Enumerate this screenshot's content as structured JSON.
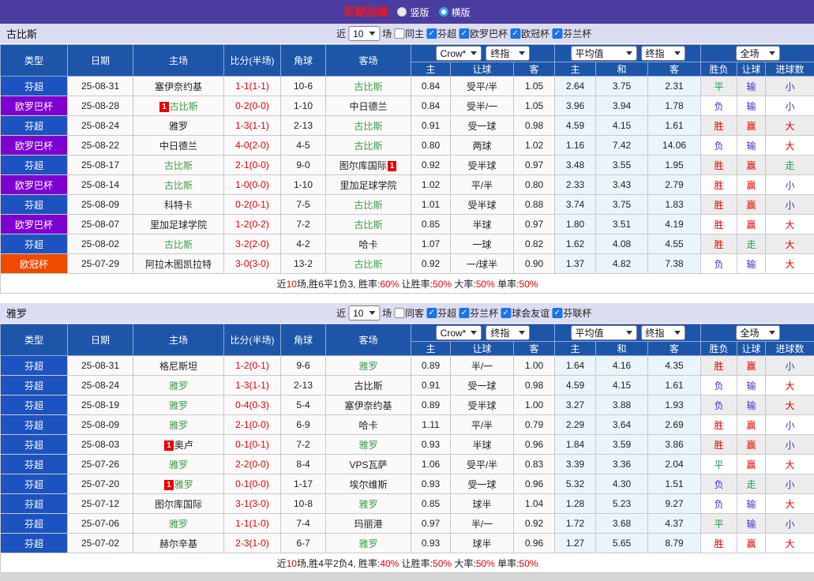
{
  "header": {
    "title": "近期战绩",
    "radios": [
      {
        "label": "竖版",
        "checked": false
      },
      {
        "label": "横版",
        "checked": true
      }
    ]
  },
  "controls": {
    "bookmaker": "Crow*",
    "stage": "终指",
    "average": "平均值",
    "stage2": "终指",
    "scope": "全场"
  },
  "thead": {
    "type": "类型",
    "date": "日期",
    "home": "主场",
    "score": "比分(半场)",
    "corner": "角球",
    "away": "客场",
    "sub": [
      "主",
      "让球",
      "客",
      "主",
      "和",
      "客",
      "胜负",
      "让球",
      "进球数"
    ]
  },
  "colors": {
    "topbar_purple": "#4b3c9f",
    "header_blue": "#1d55a9",
    "league": {
      "芬超": "#1c53c0",
      "欧罗巴杯": "#7e00d0",
      "欧冠杯": "#f04a00"
    },
    "result": {
      "胜": "#e60000",
      "赢": "#e60000",
      "大": "#e60000",
      "负": "#3535d6",
      "输": "#3535d6",
      "小": "#3535d6",
      "平": "#1e9e46",
      "走": "#1e9e46"
    },
    "team_green": "#3c9e4a",
    "score_red": "#e60000",
    "check_blue": "#1b74e8"
  },
  "sections": [
    {
      "team": "古比斯",
      "filter": {
        "near": "近",
        "count": "10",
        "games": "场",
        "same": {
          "label": "同主",
          "checked": false
        },
        "leagues": [
          {
            "label": "芬超",
            "checked": true
          },
          {
            "label": "欧罗巴杯",
            "checked": true
          },
          {
            "label": "欧冠杯",
            "checked": true
          },
          {
            "label": "芬兰杯",
            "checked": true
          }
        ]
      },
      "rows": [
        {
          "lg": "芬超",
          "date": "25-08-31",
          "home": {
            "n": "塞伊奈约基"
          },
          "score": "1-1(1-1)",
          "corner": "10-6",
          "away": {
            "n": "古比斯",
            "g": 1
          },
          "o": [
            "0.84",
            "受平/半",
            "1.05"
          ],
          "avg": [
            "2.64",
            "3.75",
            "2.31"
          ],
          "res": [
            "平",
            "输",
            "小"
          ]
        },
        {
          "lg": "欧罗巴杯",
          "date": "25-08-28",
          "home": {
            "n": "古比斯",
            "g": 1,
            "cb": 1
          },
          "score": "0-2(0-0)",
          "corner": "1-10",
          "away": {
            "n": "中日德兰"
          },
          "o": [
            "0.84",
            "受半/一",
            "1.05"
          ],
          "avg": [
            "3.96",
            "3.94",
            "1.78"
          ],
          "res": [
            "负",
            "输",
            "小"
          ]
        },
        {
          "lg": "芬超",
          "date": "25-08-24",
          "home": {
            "n": "雅罗"
          },
          "score": "1-3(1-1)",
          "corner": "2-13",
          "away": {
            "n": "古比斯",
            "g": 1
          },
          "o": [
            "0.91",
            "受一球",
            "0.98"
          ],
          "avg": [
            "4.59",
            "4.15",
            "1.61"
          ],
          "res": [
            "胜",
            "赢",
            "大"
          ]
        },
        {
          "lg": "欧罗巴杯",
          "date": "25-08-22",
          "home": {
            "n": "中日德兰"
          },
          "score": "4-0(2-0)",
          "corner": "4-5",
          "away": {
            "n": "古比斯",
            "g": 1
          },
          "o": [
            "0.80",
            "两球",
            "1.02"
          ],
          "avg": [
            "1.16",
            "7.42",
            "14.06"
          ],
          "res": [
            "负",
            "输",
            "大"
          ]
        },
        {
          "lg": "芬超",
          "date": "25-08-17",
          "home": {
            "n": "古比斯",
            "g": 1
          },
          "score": "2-1(0-0)",
          "corner": "9-0",
          "away": {
            "n": "图尔库国际",
            "ca": 1
          },
          "o": [
            "0.92",
            "受半球",
            "0.97"
          ],
          "avg": [
            "3.48",
            "3.55",
            "1.95"
          ],
          "res": [
            "胜",
            "赢",
            "走"
          ]
        },
        {
          "lg": "欧罗巴杯",
          "date": "25-08-14",
          "home": {
            "n": "古比斯",
            "g": 1
          },
          "score": "1-0(0-0)",
          "corner": "1-10",
          "away": {
            "n": "里加足球学院"
          },
          "o": [
            "1.02",
            "平/半",
            "0.80"
          ],
          "avg": [
            "2.33",
            "3.43",
            "2.79"
          ],
          "res": [
            "胜",
            "赢",
            "小"
          ]
        },
        {
          "lg": "芬超",
          "date": "25-08-09",
          "home": {
            "n": "科特卡"
          },
          "score": "0-2(0-1)",
          "corner": "7-5",
          "away": {
            "n": "古比斯",
            "g": 1
          },
          "o": [
            "1.01",
            "受半球",
            "0.88"
          ],
          "avg": [
            "3.74",
            "3.75",
            "1.83"
          ],
          "res": [
            "胜",
            "赢",
            "小"
          ]
        },
        {
          "lg": "欧罗巴杯",
          "date": "25-08-07",
          "home": {
            "n": "里加足球学院"
          },
          "score": "1-2(0-2)",
          "corner": "7-2",
          "away": {
            "n": "古比斯",
            "g": 1
          },
          "o": [
            "0.85",
            "半球",
            "0.97"
          ],
          "avg": [
            "1.80",
            "3.51",
            "4.19"
          ],
          "res": [
            "胜",
            "赢",
            "大"
          ]
        },
        {
          "lg": "芬超",
          "date": "25-08-02",
          "home": {
            "n": "古比斯",
            "g": 1
          },
          "score": "3-2(2-0)",
          "corner": "4-2",
          "away": {
            "n": "哈卡"
          },
          "o": [
            "1.07",
            "一球",
            "0.82"
          ],
          "avg": [
            "1.62",
            "4.08",
            "4.55"
          ],
          "res": [
            "胜",
            "走",
            "大"
          ]
        },
        {
          "lg": "欧冠杯",
          "date": "25-07-29",
          "home": {
            "n": "阿拉木图凯拉特"
          },
          "score": "3-0(3-0)",
          "corner": "13-2",
          "away": {
            "n": "古比斯",
            "g": 1
          },
          "o": [
            "0.92",
            "一/球半",
            "0.90"
          ],
          "avg": [
            "1.37",
            "4.82",
            "7.38"
          ],
          "res": [
            "负",
            "输",
            "大"
          ]
        }
      ],
      "summary": [
        {
          "t": "近"
        },
        {
          "t": "10",
          "r": 1
        },
        {
          "t": "场,胜6平1负3, 胜率:"
        },
        {
          "t": "60%",
          "r": 1
        },
        {
          "t": " 让胜率:"
        },
        {
          "t": "50%",
          "r": 1
        },
        {
          "t": " 大率:"
        },
        {
          "t": "50%",
          "r": 1
        },
        {
          "t": " 单率:"
        },
        {
          "t": "50%",
          "r": 1
        }
      ]
    },
    {
      "team": "雅罗",
      "filter": {
        "near": "近",
        "count": "10",
        "games": "场",
        "same": {
          "label": "同客",
          "checked": false
        },
        "leagues": [
          {
            "label": "芬超",
            "checked": true
          },
          {
            "label": "芬兰杯",
            "checked": true
          },
          {
            "label": "球会友谊",
            "checked": true
          },
          {
            "label": "芬联杯",
            "checked": true
          }
        ]
      },
      "rows": [
        {
          "lg": "芬超",
          "date": "25-08-31",
          "home": {
            "n": "格尼斯坦"
          },
          "score": "1-2(0-1)",
          "corner": "9-6",
          "away": {
            "n": "雅罗",
            "g": 1
          },
          "o": [
            "0.89",
            "半/一",
            "1.00"
          ],
          "avg": [
            "1.64",
            "4.16",
            "4.35"
          ],
          "res": [
            "胜",
            "赢",
            "小"
          ]
        },
        {
          "lg": "芬超",
          "date": "25-08-24",
          "home": {
            "n": "雅罗",
            "g": 1
          },
          "score": "1-3(1-1)",
          "corner": "2-13",
          "away": {
            "n": "古比斯"
          },
          "o": [
            "0.91",
            "受一球",
            "0.98"
          ],
          "avg": [
            "4.59",
            "4.15",
            "1.61"
          ],
          "res": [
            "负",
            "输",
            "大"
          ]
        },
        {
          "lg": "芬超",
          "date": "25-08-19",
          "home": {
            "n": "雅罗",
            "g": 1
          },
          "score": "0-4(0-3)",
          "corner": "5-4",
          "away": {
            "n": "塞伊奈约基"
          },
          "o": [
            "0.89",
            "受半球",
            "1.00"
          ],
          "avg": [
            "3.27",
            "3.88",
            "1.93"
          ],
          "res": [
            "负",
            "输",
            "大"
          ]
        },
        {
          "lg": "芬超",
          "date": "25-08-09",
          "home": {
            "n": "雅罗",
            "g": 1
          },
          "score": "2-1(0-0)",
          "corner": "6-9",
          "away": {
            "n": "哈卡"
          },
          "o": [
            "1.11",
            "平/半",
            "0.79"
          ],
          "avg": [
            "2.29",
            "3.64",
            "2.69"
          ],
          "res": [
            "胜",
            "赢",
            "小"
          ]
        },
        {
          "lg": "芬超",
          "date": "25-08-03",
          "home": {
            "n": "奥卢",
            "cb": 1
          },
          "score": "0-1(0-1)",
          "corner": "7-2",
          "away": {
            "n": "雅罗",
            "g": 1
          },
          "o": [
            "0.93",
            "半球",
            "0.96"
          ],
          "avg": [
            "1.84",
            "3.59",
            "3.86"
          ],
          "res": [
            "胜",
            "赢",
            "小"
          ]
        },
        {
          "lg": "芬超",
          "date": "25-07-26",
          "home": {
            "n": "雅罗",
            "g": 1
          },
          "score": "2-2(0-0)",
          "corner": "8-4",
          "away": {
            "n": "VPS瓦萨"
          },
          "o": [
            "1.06",
            "受平/半",
            "0.83"
          ],
          "avg": [
            "3.39",
            "3.36",
            "2.04"
          ],
          "res": [
            "平",
            "赢",
            "大"
          ]
        },
        {
          "lg": "芬超",
          "date": "25-07-20",
          "home": {
            "n": "雅罗",
            "g": 1,
            "cb": 1
          },
          "score": "0-1(0-0)",
          "corner": "1-17",
          "away": {
            "n": "埃尔维斯"
          },
          "o": [
            "0.93",
            "受一球",
            "0.96"
          ],
          "avg": [
            "5.32",
            "4.30",
            "1.51"
          ],
          "res": [
            "负",
            "走",
            "小"
          ]
        },
        {
          "lg": "芬超",
          "date": "25-07-12",
          "home": {
            "n": "图尔库国际"
          },
          "score": "3-1(3-0)",
          "corner": "10-8",
          "away": {
            "n": "雅罗",
            "g": 1
          },
          "o": [
            "0.85",
            "球半",
            "1.04"
          ],
          "avg": [
            "1.28",
            "5.23",
            "9.27"
          ],
          "res": [
            "负",
            "输",
            "大"
          ]
        },
        {
          "lg": "芬超",
          "date": "25-07-06",
          "home": {
            "n": "雅罗",
            "g": 1
          },
          "score": "1-1(1-0)",
          "corner": "7-4",
          "away": {
            "n": "玛丽港"
          },
          "o": [
            "0.97",
            "半/一",
            "0.92"
          ],
          "avg": [
            "1.72",
            "3.68",
            "4.37"
          ],
          "res": [
            "平",
            "输",
            "小"
          ]
        },
        {
          "lg": "芬超",
          "date": "25-07-02",
          "home": {
            "n": "赫尔辛基"
          },
          "score": "2-3(1-0)",
          "corner": "6-7",
          "away": {
            "n": "雅罗",
            "g": 1
          },
          "o": [
            "0.93",
            "球半",
            "0.96"
          ],
          "avg": [
            "1.27",
            "5.65",
            "8.79"
          ],
          "res": [
            "胜",
            "赢",
            "大"
          ]
        }
      ],
      "summary": [
        {
          "t": "近"
        },
        {
          "t": "10",
          "r": 1
        },
        {
          "t": "场,胜4平2负4, 胜率:"
        },
        {
          "t": "40%",
          "r": 1
        },
        {
          "t": " 让胜率:"
        },
        {
          "t": "50%",
          "r": 1
        },
        {
          "t": " 大率:"
        },
        {
          "t": "50%",
          "r": 1
        },
        {
          "t": " 单率:"
        },
        {
          "t": "50%",
          "r": 1
        }
      ]
    }
  ]
}
